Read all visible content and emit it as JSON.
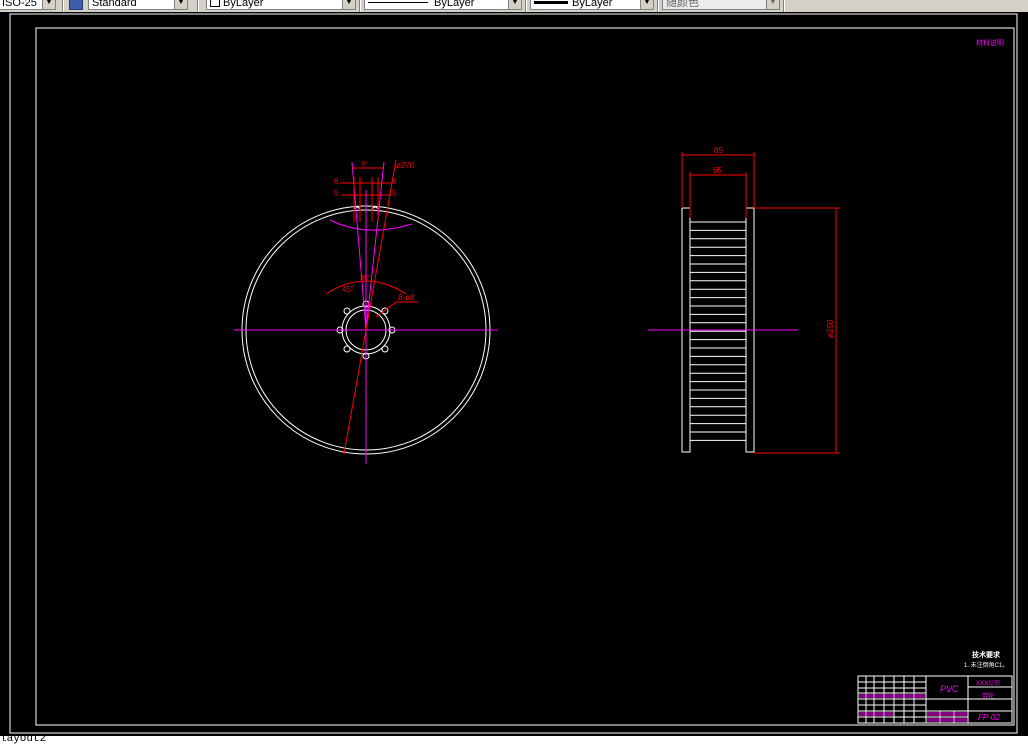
{
  "toolbar": {
    "dimstyle_value": "ISO-25",
    "textstyle_value": "Standard",
    "layer_value": "ByLayer",
    "linetype_label": "ByLayer",
    "lineweight_label": "ByLayer",
    "color_value": "随颜色"
  },
  "drawing": {
    "front_dims": {
      "d270": "ø270",
      "angle_top": "9°",
      "six_left": "6",
      "six_right": "6",
      "five_left": "5",
      "five_right": "5",
      "angle_45": "45°",
      "angle_small": "30°",
      "bolt_hole": "8-ø8"
    },
    "side_dims": {
      "w85": "85",
      "w65": "65",
      "d250": "ø250"
    },
    "corner_note": "材料说明",
    "tech_req_title": "技术要求",
    "tech_req_line": "1. 未注倒角C1。",
    "title_block": {
      "material": "PVC",
      "company": "XXX公司",
      "part_name": "带轮",
      "drawing_no": "FP-02"
    }
  },
  "colors": {
    "background": "#000000",
    "geometry": "#ffffff",
    "dimension": "#ff0000",
    "centerline": "#ff00ff"
  },
  "command_line": "layout2"
}
